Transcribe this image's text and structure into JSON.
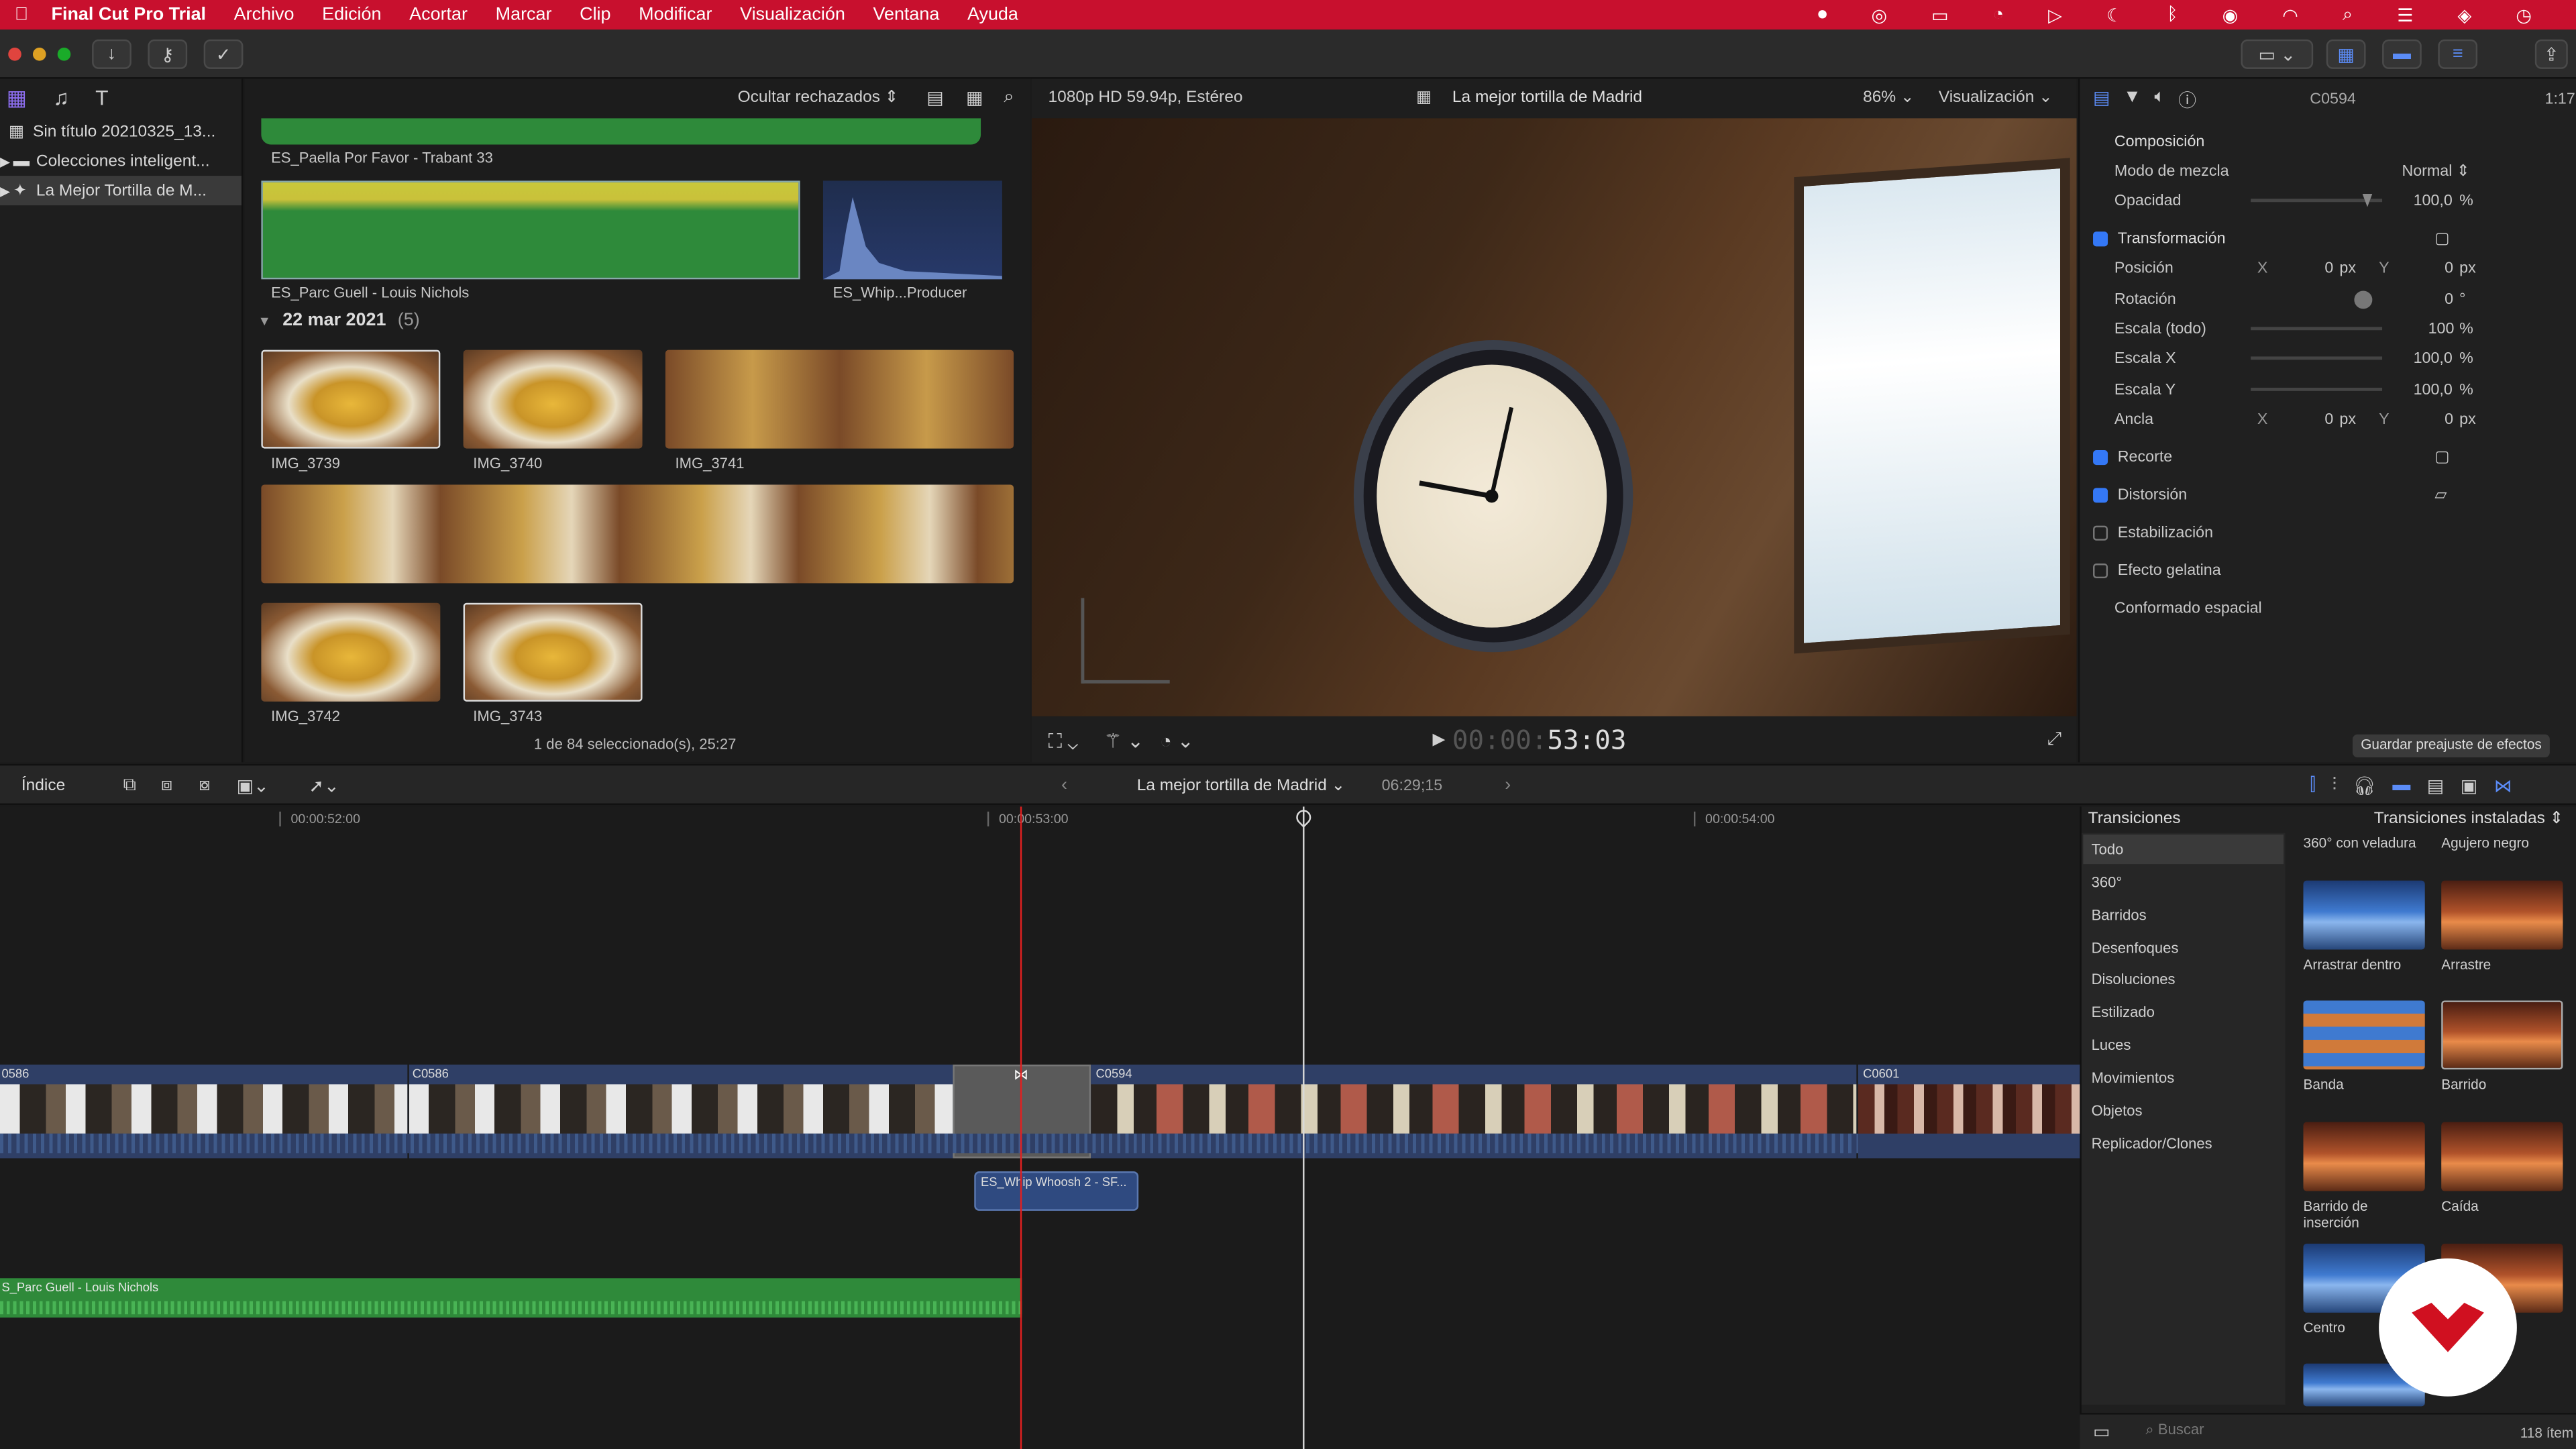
{
  "menubar": {
    "app": "Final Cut Pro Trial",
    "items": [
      "Archivo",
      "Edición",
      "Acortar",
      "Marcar",
      "Clip",
      "Modificar",
      "Visualización",
      "Ventana",
      "Ayuda"
    ]
  },
  "browser": {
    "filter_label": "Ocultar rechazados",
    "library_items": [
      "Sin título 20210325_13...",
      "Colecciones inteligent...",
      "La Mejor Tortilla de M..."
    ],
    "clips_top": [
      "ES_Paella Por Favor - Trabant 33",
      "ES_Parc Guell - Louis Nichols",
      "ES_Whip...Producer"
    ],
    "date_group": "22 mar 2021",
    "date_count": "(5)",
    "images": [
      "IMG_3739",
      "IMG_3740",
      "IMG_3741",
      "IMG_3742",
      "IMG_3743"
    ],
    "status": "1 de 84 seleccionado(s), 25:27"
  },
  "viewer": {
    "format": "1080p HD 59.94p, Estéreo",
    "title": "La mejor tortilla de Madrid",
    "zoom": "86%",
    "view_menu": "Visualización",
    "timecode_dim": "00:00:",
    "timecode": "53:03"
  },
  "inspector": {
    "clip_name": "C0594",
    "duration": "1:17",
    "composicion": "Composición",
    "rows": [
      {
        "label": "Modo de mezcla",
        "value": "Normal"
      },
      {
        "label": "Opacidad",
        "value": "100,0",
        "unit": "%"
      }
    ],
    "transformacion": "Transformación",
    "transform_rows": [
      {
        "label": "Posición",
        "x": "0",
        "y": "0",
        "unit": "px"
      },
      {
        "label": "Rotación",
        "value": "0",
        "unit": "°"
      },
      {
        "label": "Escala (todo)",
        "value": "100",
        "unit": "%"
      },
      {
        "label": "Escala X",
        "value": "100,0",
        "unit": "%"
      },
      {
        "label": "Escala Y",
        "value": "100,0",
        "unit": "%"
      },
      {
        "label": "Ancla",
        "x": "0",
        "y": "0",
        "unit": "px"
      }
    ],
    "sections": [
      "Recorte",
      "Distorsión",
      "Estabilización",
      "Efecto gelatina"
    ],
    "conformado": "Conformado espacial",
    "save_preset": "Guardar preajuste de efectos",
    "axis_x": "X",
    "axis_y": "Y"
  },
  "timeline": {
    "index_label": "Índice",
    "project": "La mejor tortilla de Madrid",
    "duration": "06:29;15",
    "ruler": [
      "00:00:52:00",
      "00:00:53:00",
      "00:00:54:00"
    ],
    "clips": [
      "0586",
      "C0586",
      "C0594",
      "C0601"
    ],
    "sfx_clip": "ES_Whip Whoosh 2 - SF...",
    "music_clip": "S_Parc Guell - Louis Nichols"
  },
  "transitions": {
    "title": "Transiciones",
    "installed": "Transiciones instaladas",
    "categories": [
      "Todo",
      "360°",
      "Barridos",
      "Desenfoques",
      "Disoluciones",
      "Estilizado",
      "Luces",
      "Movimientos",
      "Objetos",
      "Replicador/Clones"
    ],
    "top_labels": [
      "360° con veladura",
      "Agujero negro"
    ],
    "items": [
      "Arrastrar dentro",
      "Arrastre",
      "Banda",
      "Barrido",
      "Barrido de inserción",
      "Caída",
      "Centro"
    ],
    "search_placeholder": "Buscar",
    "count": "118 ítem"
  },
  "colors": {
    "menubar": "#c8102e",
    "clip_blue": "#2f3f66",
    "audio_green": "#2f8a3a",
    "playhead_red": "#e02020"
  }
}
